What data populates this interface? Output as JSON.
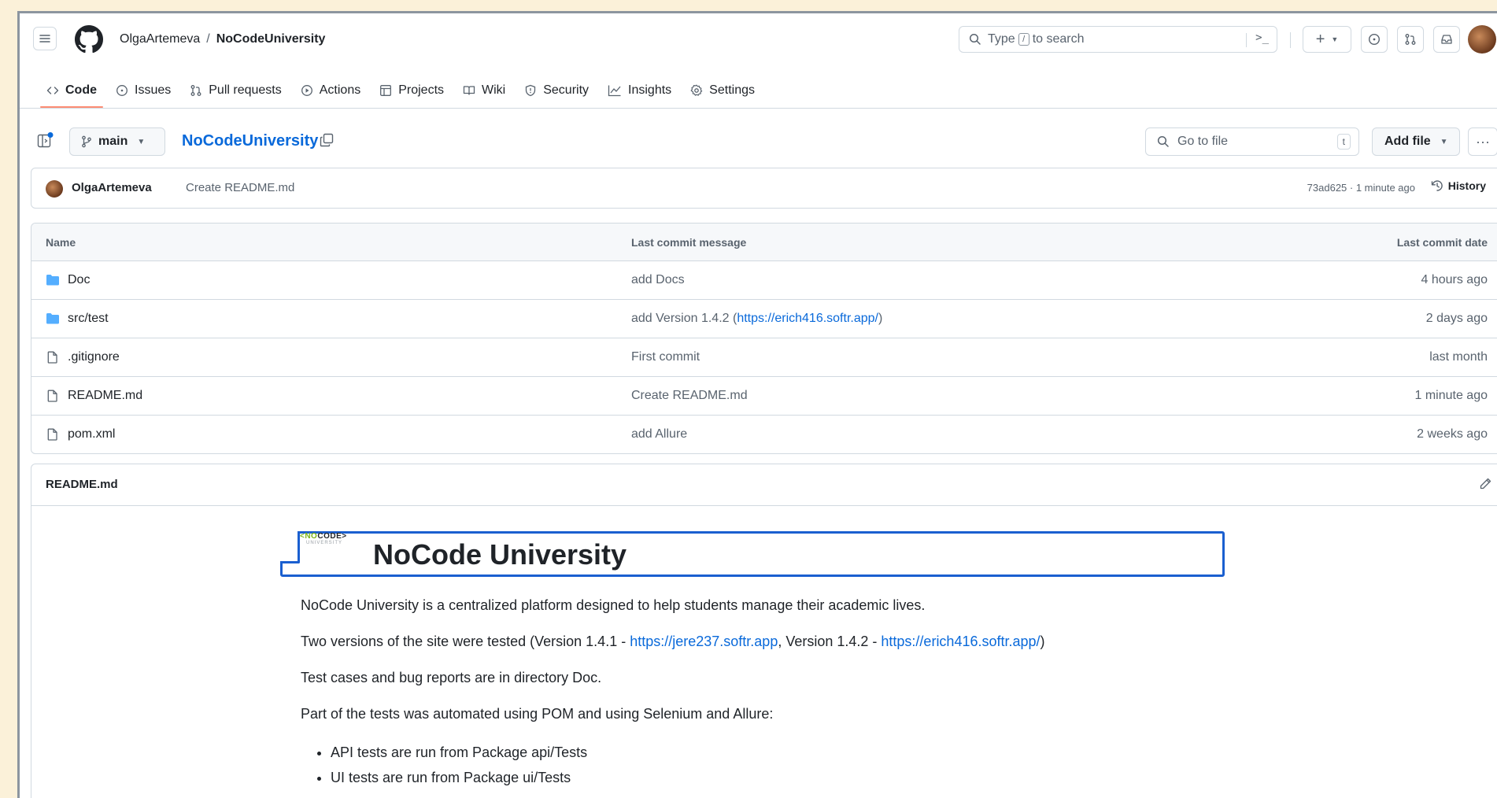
{
  "header": {
    "owner": "OlgaArtemeva",
    "separator": "/",
    "repo": "NoCodeUniversity",
    "search_prefix": "Type",
    "search_key": "/",
    "search_suffix": "to search",
    "command_glyph": ">_"
  },
  "tabs": [
    {
      "label": "Code",
      "icon": "code-icon",
      "active": true
    },
    {
      "label": "Issues",
      "icon": "issue-icon"
    },
    {
      "label": "Pull requests",
      "icon": "pull-request-icon"
    },
    {
      "label": "Actions",
      "icon": "play-icon"
    },
    {
      "label": "Projects",
      "icon": "table-icon"
    },
    {
      "label": "Wiki",
      "icon": "book-icon"
    },
    {
      "label": "Security",
      "icon": "shield-icon"
    },
    {
      "label": "Insights",
      "icon": "graph-icon"
    },
    {
      "label": "Settings",
      "icon": "gear-icon"
    }
  ],
  "repobar": {
    "branch": "main",
    "repo_link": "NoCodeUniversity",
    "go_to_file": "Go to file",
    "go_to_file_key": "t",
    "add_file": "Add file",
    "more": "···"
  },
  "commit": {
    "author": "OlgaArtemeva",
    "message": "Create README.md",
    "meta": "73ad625 · 1 minute ago",
    "history": "History"
  },
  "files": {
    "headers": {
      "name": "Name",
      "message": "Last commit message",
      "date": "Last commit date"
    },
    "rows": [
      {
        "name": "Doc",
        "type": "folder",
        "message": "add Docs",
        "date": "4 hours ago"
      },
      {
        "name": "src/test",
        "type": "folder",
        "message_prefix": "add Version 1.4.2 (",
        "message_link": "https://erich416.softr.app/",
        "message_suffix": ")",
        "date": "2 days ago"
      },
      {
        "name": ".gitignore",
        "type": "file",
        "message": "First commit",
        "date": "last month"
      },
      {
        "name": "README.md",
        "type": "file",
        "message": "Create README.md",
        "date": "1 minute ago"
      },
      {
        "name": "pom.xml",
        "type": "file",
        "message": "add Allure",
        "date": "2 weeks ago"
      }
    ]
  },
  "readme": {
    "filename": "README.md",
    "logo_left": "<NO",
    "logo_right": "CODE>",
    "logo_sub": "UNIVERSITY",
    "title": "NoCode University",
    "p1": "NoCode University is a centralized platform designed to help students manage their academic lives.",
    "p2_prefix": "Two versions of the site were tested (Version 1.4.1 - ",
    "p2_link1": "https://jere237.softr.app",
    "p2_mid": ", Version 1.4.2 - ",
    "p2_link2": "https://erich416.softr.app/",
    "p2_suffix": ")",
    "p3": "Test cases and bug reports are in directory Doc.",
    "p4": "Part of the tests was automated using POM and using Selenium and Allure:",
    "bullets": [
      "API tests are run from Package api/Tests",
      "UI tests are run from Package ui/Tests"
    ]
  },
  "colors": {
    "accent": "#0969da",
    "tab_underline": "#fd8c73",
    "folder": "#54aeff",
    "banner_border": "#1a5fd0"
  }
}
